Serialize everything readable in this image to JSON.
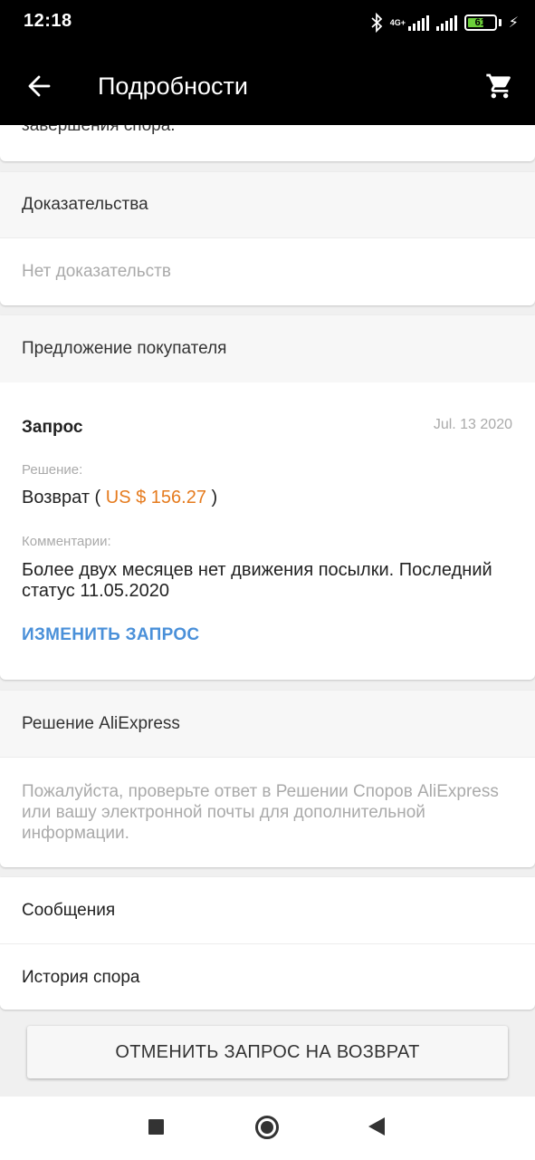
{
  "status_bar": {
    "time": "12:18",
    "network": "4G+",
    "battery": "61",
    "battery_level": 0.61,
    "icons": [
      "bluetooth-icon",
      "signal-icon",
      "signal-icon",
      "battery-icon",
      "charging-icon"
    ]
  },
  "app_bar": {
    "title": "Подробности",
    "back_icon": "arrow-back-icon",
    "cart_icon": "shopping-cart-icon"
  },
  "cut_off_text": "завершения спора.",
  "evidence": {
    "header": "Доказательства",
    "empty": "Нет доказательств"
  },
  "buyer_proposal": {
    "header": "Предложение покупателя",
    "request_title": "Запрос",
    "date": "Jul. 13 2020",
    "decision_label": "Решение:",
    "decision_prefix": "Возврат ( ",
    "decision_amount": "US $ 156.27",
    "decision_suffix": " )",
    "comments_label": "Комментарии:",
    "comment": "Более двух месяцев нет движения посылки. Последний статус 11.05.2020",
    "change_link": "ИЗМЕНИТЬ ЗАПРОС"
  },
  "aliexpress_decision": {
    "header": "Решение AliExpress",
    "text": "Пожалуйста, проверьте ответ в Решении Споров AliExpress или вашу электронной почты для дополнительной информации."
  },
  "links": {
    "messages": "Сообщения",
    "dispute_history": "История спора"
  },
  "cancel_button": "ОТМЕНИТЬ ЗАПРОС НА ВОЗВРАТ",
  "colors": {
    "accent_link": "#4a90d9",
    "amount": "#e57b1e",
    "app_bar": "#000000"
  },
  "nav_bar": {
    "icons": [
      "recent-apps-icon",
      "home-icon",
      "back-icon"
    ]
  }
}
